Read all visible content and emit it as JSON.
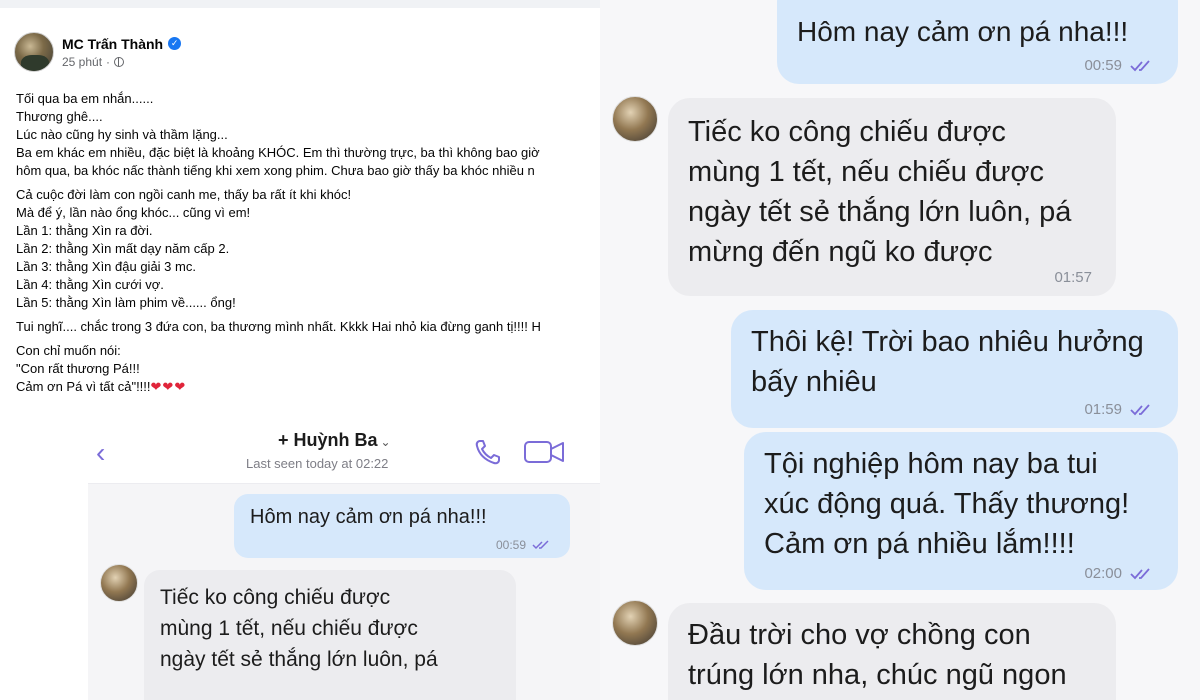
{
  "fb_post": {
    "author": "MC Trấn Thành",
    "time": "25 phút",
    "paragraphs": [
      [
        "Tối qua ba em nhắn......",
        "Thương ghê....",
        "Lúc nào cũng hy sinh và thầm lặng...",
        "Ba em khác em nhiều, đặc biệt là khoảng KHÓC. Em thì thường trực, ba thì không bao giờ",
        "hôm qua, ba khóc nấc thành tiếng khi xem xong phim. Chưa bao giờ thấy ba khóc nhiều n"
      ],
      [
        "Cả cuộc đời làm con ngồi canh me, thấy ba rất ít khi khóc!",
        "Mà để ý, lần nào ổng khóc... cũng vì em!",
        "Lần 1: thằng Xìn ra đời.",
        "Lần 2: thằng Xìn mất dạy năm cấp 2.",
        "Lần 3: thằng Xìn đậu giải 3 mc.",
        "Lần 4: thằng Xìn cưới vợ.",
        "Lần 5: thằng Xìn làm phim về...... ổng!"
      ],
      [
        "Tui nghĩ.... chắc trong 3 đứa con, ba thương mình nhất. Kkkk Hai nhỏ kia đừng ganh tị!!!! H"
      ],
      [
        "Con chỉ muốn nói:",
        "\"Con rất thương Pá!!!",
        "Cảm ơn Pá vì tất cả\"!!!!"
      ]
    ],
    "hearts": "❤❤❤"
  },
  "viber": {
    "back": "‹",
    "contact": "+ Huỳnh Ba",
    "chevron": "⌄",
    "last_seen": "Last seen today at 02:22",
    "msg_out": {
      "text": "Hôm nay cảm ơn pá nha!!!",
      "time": "00:59"
    },
    "msg_in": {
      "lines": [
        "Tiếc ko công chiếu được",
        "mùng 1 tết, nếu chiếu được",
        "ngày tết sẻ thắng lớn luôn, pá"
      ]
    }
  },
  "chat": {
    "m1": {
      "text": "Hôm nay cảm ơn pá nha!!!",
      "time": "00:59"
    },
    "m2": {
      "lines": [
        "Tiếc ko công chiếu được",
        "mùng 1 tết, nếu chiếu được",
        "ngày tết sẻ thắng lớn luôn, pá",
        "mừng đến ngũ ko được"
      ],
      "time": "01:57"
    },
    "m3": {
      "lines": [
        "Thôi kệ! Trời bao nhiêu hưởng",
        "bấy nhiêu"
      ],
      "time": "01:59"
    },
    "m4": {
      "lines": [
        "Tội nghiệp hôm nay ba tui",
        "xúc động quá. Thấy thương!",
        "Cảm ơn pá nhiều lắm!!!!"
      ],
      "time": "02:00"
    },
    "m5": {
      "lines": [
        "Đầu trời cho vợ chồng con",
        "trúng lớn nha, chúc ngũ ngon"
      ]
    }
  },
  "colors": {
    "viber_accent": "#7b6cd8",
    "bubble_out": "#d6e8fb",
    "bubble_in": "#ececef",
    "fb_blue": "#1877f2",
    "heart": "#e0243a"
  },
  "icons": [
    "verified-badge-icon",
    "globe-icon",
    "back-chevron-icon",
    "phone-icon",
    "video-camera-icon",
    "double-check-icon"
  ]
}
